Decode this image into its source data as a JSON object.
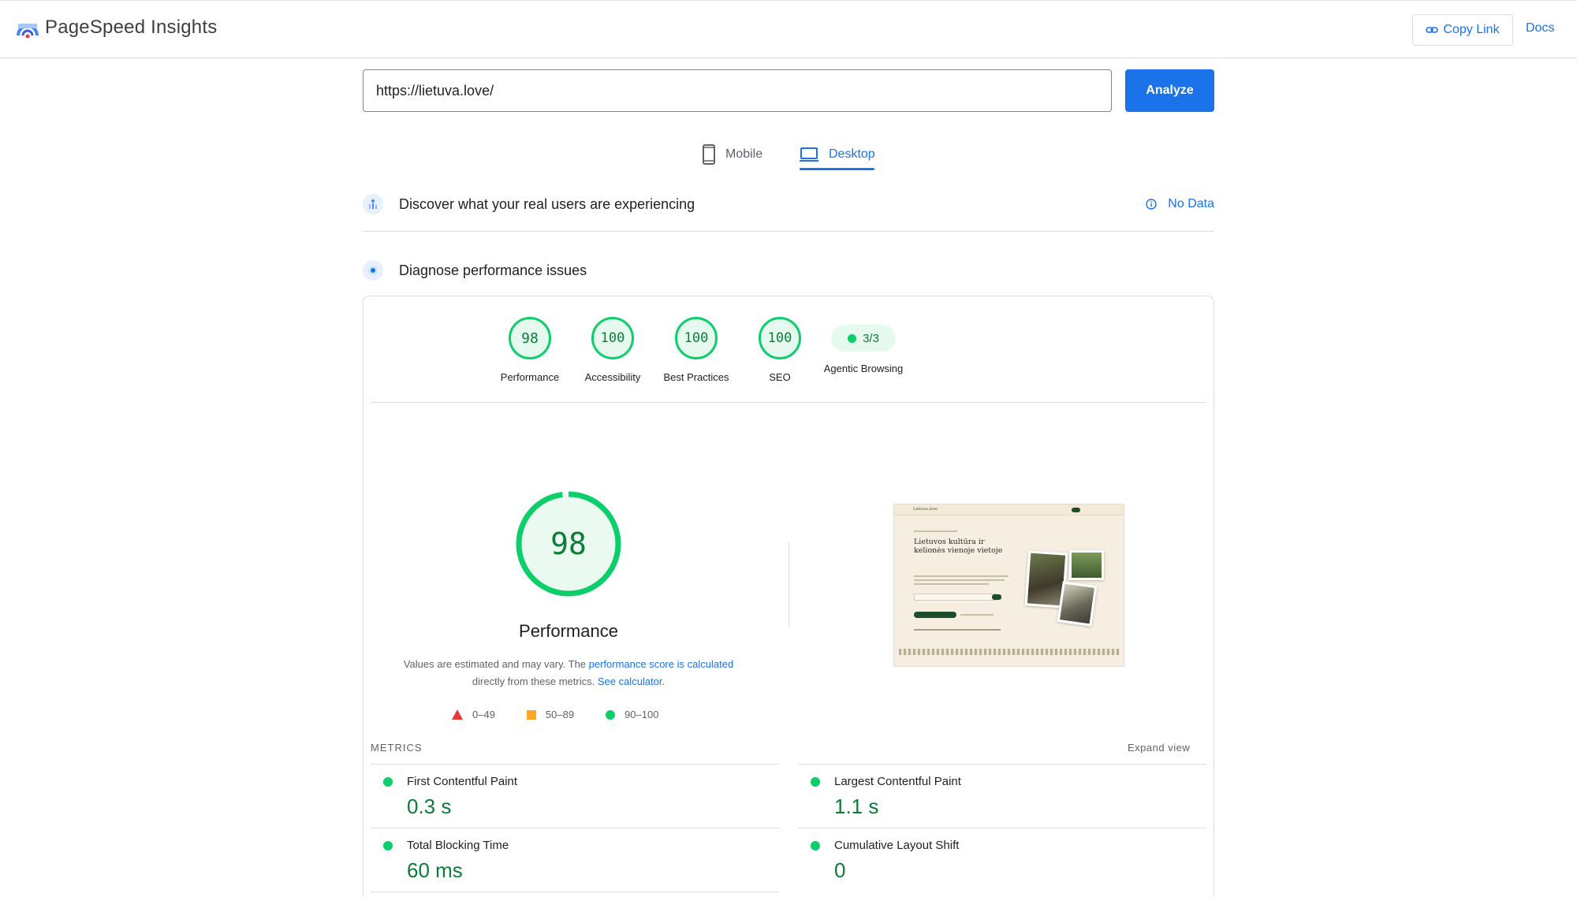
{
  "header": {
    "brand": "PageSpeed Insights",
    "copy_link_label": "Copy Link",
    "docs_label": "Docs"
  },
  "search": {
    "url_value": "https://lietuva.love/",
    "analyze_label": "Analyze"
  },
  "device_tabs": [
    {
      "label": "Mobile",
      "selected": false
    },
    {
      "label": "Desktop",
      "selected": true
    }
  ],
  "sections": {
    "discover_title": "Discover what your real users are experiencing",
    "discover_status": "No Data",
    "diagnose_title": "Diagnose performance issues"
  },
  "scores": [
    {
      "label": "Performance",
      "value": "98"
    },
    {
      "label": "Accessibility",
      "value": "100"
    },
    {
      "label": "Best Practices",
      "value": "100"
    },
    {
      "label": "SEO",
      "value": "100"
    },
    {
      "label": "Agentic Browsing",
      "value": "3/3"
    }
  ],
  "performance": {
    "score": "98",
    "score_fraction": 0.98,
    "title": "Performance",
    "desc_1": "Values are estimated and may vary. The ",
    "desc_link_1": "performance score is calculated",
    "desc_2": " directly from these metrics. ",
    "desc_link_2": "See calculator.",
    "legend": [
      "0–49",
      "50–89",
      "90–100"
    ]
  },
  "screenshot": {
    "headline": "Lietuvos kultūra ir kelionės vienoje vietoje",
    "site_name": "Lietuva.love"
  },
  "metrics": {
    "label": "METRICS",
    "expand_label": "Expand view",
    "items": [
      {
        "name": "First Contentful Paint",
        "value": "0.3 s"
      },
      {
        "name": "Largest Contentful Paint",
        "value": "1.1 s"
      },
      {
        "name": "Total Blocking Time",
        "value": "60 ms"
      },
      {
        "name": "Cumulative Layout Shift",
        "value": "0"
      }
    ]
  },
  "colors": {
    "accent": "#1a73e8",
    "pass": "#0cce6b",
    "pass_text": "#0c7c39",
    "average": "#ffa726",
    "fail": "#e53935"
  }
}
